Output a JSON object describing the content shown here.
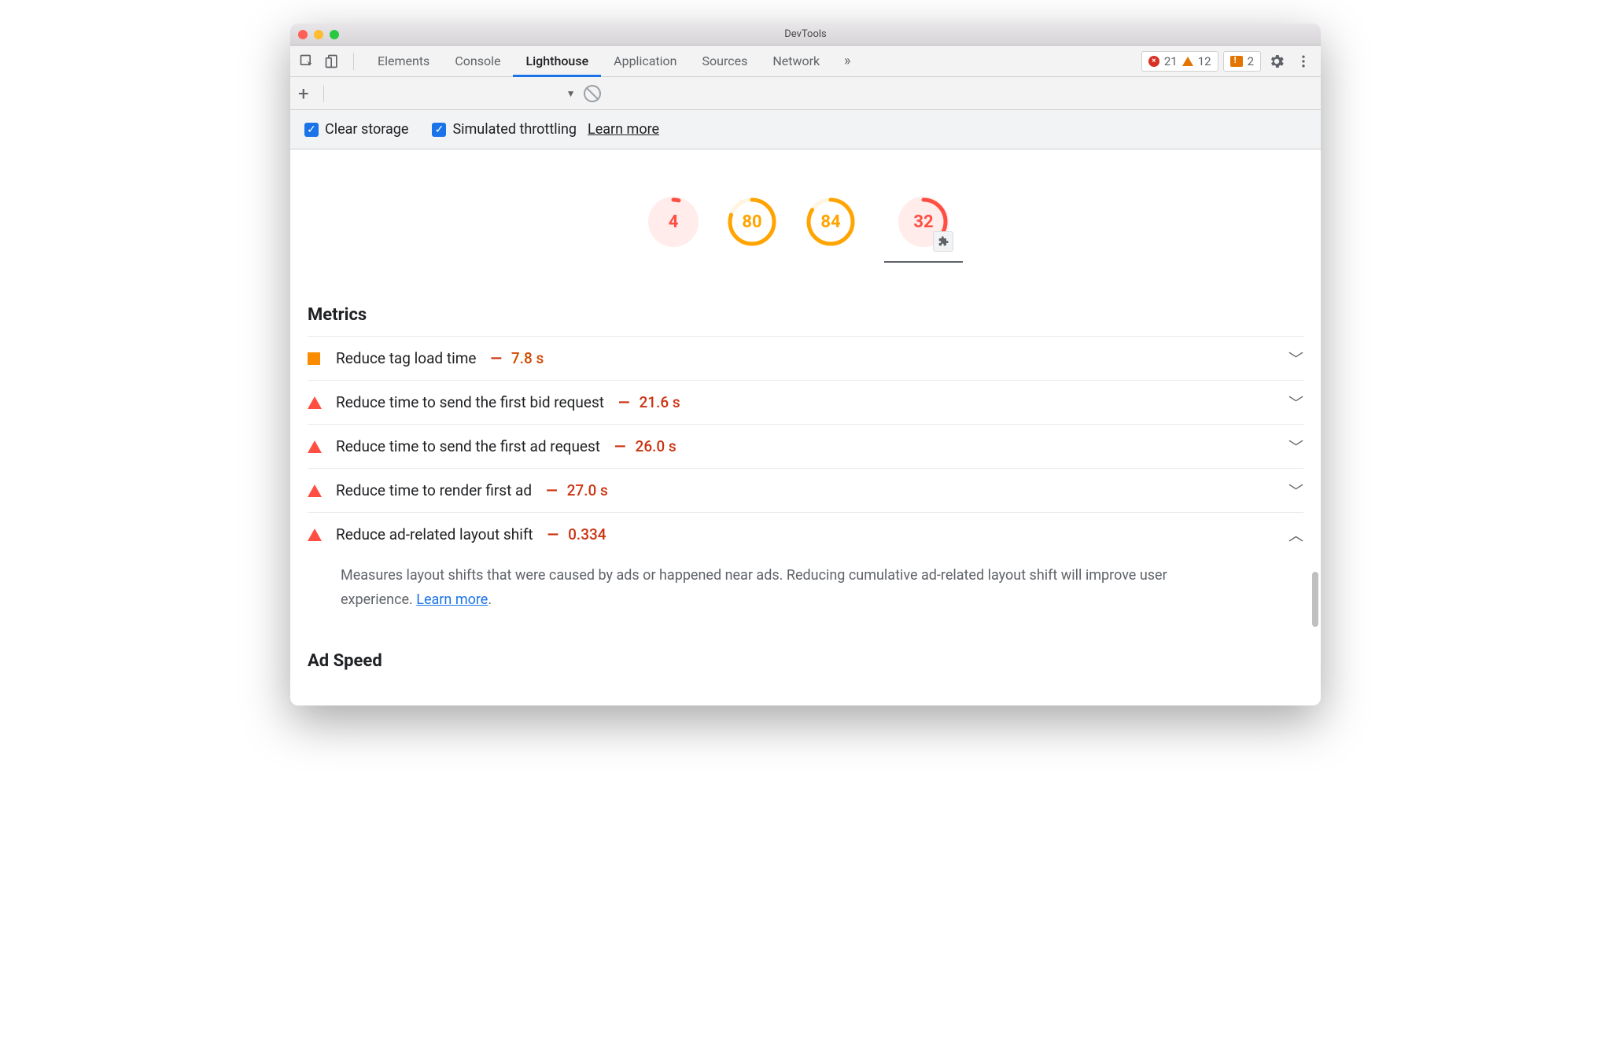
{
  "window": {
    "title": "DevTools"
  },
  "tabs": {
    "items": [
      "Elements",
      "Console",
      "Lighthouse",
      "Application",
      "Sources",
      "Network"
    ],
    "active": "Lighthouse"
  },
  "counters": {
    "errors": "21",
    "warnings": "12",
    "messages": "2"
  },
  "options": {
    "clear_storage": "Clear storage",
    "simulated_throttling": "Simulated throttling",
    "learn_more": "Learn more"
  },
  "gauges": [
    {
      "value": "4",
      "pct": 4,
      "color": "#ff4e42",
      "bg": "#ffeceb"
    },
    {
      "value": "80",
      "pct": 80,
      "color": "#ffa400",
      "bg": "#ffffff"
    },
    {
      "value": "84",
      "pct": 84,
      "color": "#ffa400",
      "bg": "#ffffff"
    },
    {
      "value": "32",
      "pct": 32,
      "color": "#ff4e42",
      "bg": "#ffeceb",
      "extension": true,
      "underline": true
    }
  ],
  "sections": {
    "metrics_title": "Metrics",
    "ad_speed_title": "Ad Speed"
  },
  "metrics": [
    {
      "marker": "square",
      "title": "Reduce tag load time",
      "value": "7.8 s",
      "valClass": "orange",
      "expanded": false
    },
    {
      "marker": "tri",
      "title": "Reduce time to send the first bid request",
      "value": "21.6 s",
      "valClass": "red",
      "expanded": false
    },
    {
      "marker": "tri",
      "title": "Reduce time to send the first ad request",
      "value": "26.0 s",
      "valClass": "red",
      "expanded": false
    },
    {
      "marker": "tri",
      "title": "Reduce time to render first ad",
      "value": "27.0 s",
      "valClass": "red",
      "expanded": false
    },
    {
      "marker": "tri",
      "title": "Reduce ad-related layout shift",
      "value": "0.334",
      "valClass": "red",
      "expanded": true,
      "desc_pre": "Measures layout shifts that were caused by ads or happened near ads. Reducing cumulative ad-related layout shift will improve user experience. ",
      "desc_link": "Learn more",
      "desc_post": "."
    }
  ]
}
